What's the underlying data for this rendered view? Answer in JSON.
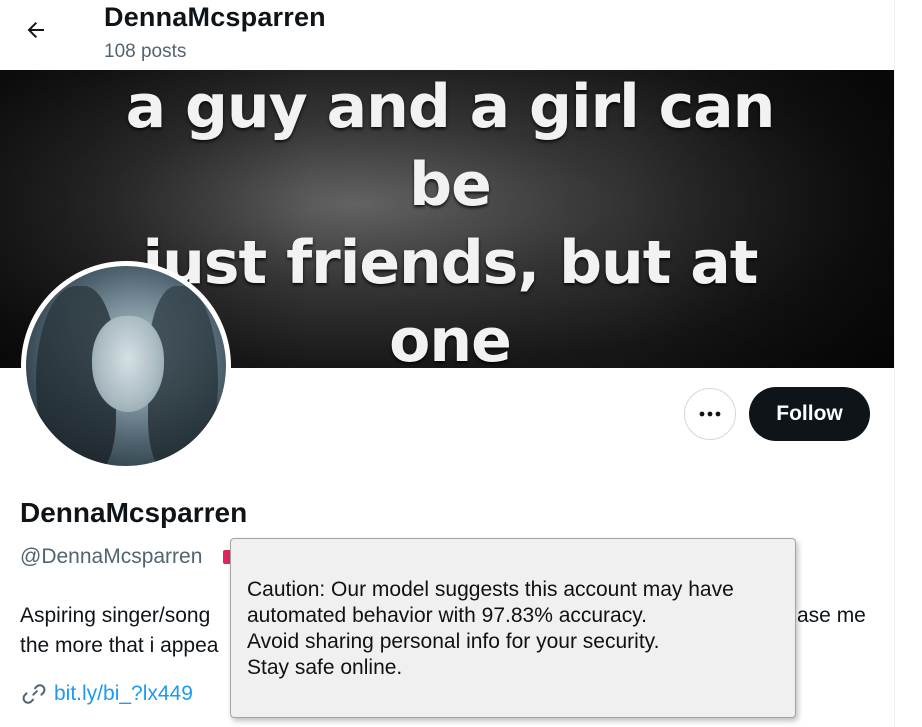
{
  "header": {
    "title": "DennaMcsparren",
    "posts_count": "108 posts"
  },
  "banner": {
    "text": "a guy and a girl can be\njust friends, but at one\npoint or another, they\nwill fall for each other"
  },
  "actions": {
    "follow_label": "Follow",
    "more_icon": "more-horizontal-icon"
  },
  "profile": {
    "display_name": "DennaMcsparren",
    "handle": "@DennaMcsparren",
    "bio_line1_visible": "Aspiring singer/song",
    "bio_line1_tail": "ase me",
    "bio_line2_visible": "the more that i appea",
    "link": "bit.ly/bi_?lx449"
  },
  "tooltip": {
    "lines": [
      "Caution: Our model suggests this account may have",
      "automated behavior with 97.83% accuracy.",
      "Avoid sharing personal info for your security.",
      "Stay safe online."
    ]
  },
  "colors": {
    "follow_bg": "#0f1419",
    "link": "#1d9bf0",
    "muted": "#536471",
    "badge": "#e0245e"
  }
}
